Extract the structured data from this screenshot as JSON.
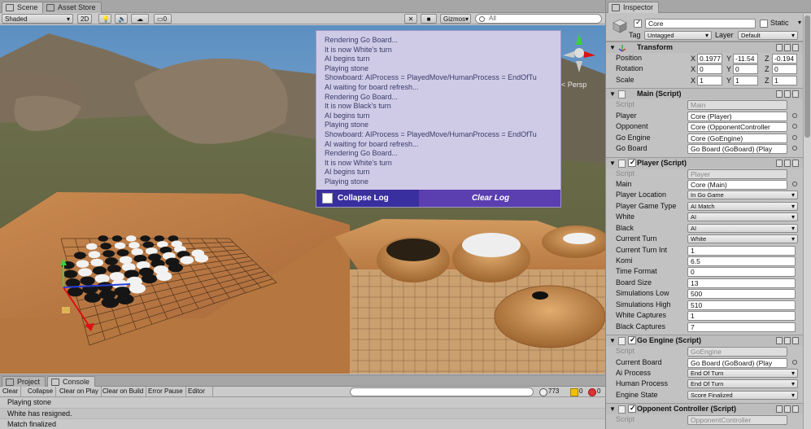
{
  "scene_panel": {
    "tabs": [
      {
        "label": "Scene",
        "active": true
      },
      {
        "label": "Asset Store",
        "active": false
      }
    ],
    "toolbar": {
      "shading_mode": "Shaded",
      "mode_2d": "2D",
      "audio_count": "0",
      "gizmos_label": "Gizmos",
      "search_placeholder": "All"
    },
    "persp_label": "< Persp",
    "debug_log": {
      "lines": [
        "Rendering Go Board...",
        "It is now White's turn",
        "AI begins turn",
        "Playing stone",
        "Showboard: AIProcess = PlayedMove/HumanProcess = EndOfTu",
        "AI waiting for board refresh...",
        "Rendering Go Board...",
        "It is now Black's turn",
        "AI begins turn",
        "Playing stone",
        "Showboard: AIProcess = PlayedMove/HumanProcess = EndOfTu",
        "AI waiting for board refresh...",
        "Rendering Go Board...",
        "It is now White's turn",
        "AI begins turn",
        "Playing stone"
      ],
      "collapse_label": "Collapse Log",
      "clear_label": "Clear Log"
    }
  },
  "inspector": {
    "tab_label": "Inspector",
    "gameobject": {
      "name": "Core",
      "static_label": "Static",
      "tag_label": "Tag",
      "tag_value": "Untagged",
      "layer_label": "Layer",
      "layer_value": "Default"
    },
    "transform": {
      "title": "Transform",
      "position": {
        "label": "Position",
        "x": "0.1977",
        "y": "-11.54",
        "z": "-0.194"
      },
      "rotation": {
        "label": "Rotation",
        "x": "0",
        "y": "0",
        "z": "0"
      },
      "scale": {
        "label": "Scale",
        "x": "1",
        "y": "1",
        "z": "1"
      }
    },
    "main_script": {
      "title": "Main (Script)",
      "script_label": "Script",
      "script_value": "Main",
      "player_label": "Player",
      "player_value": "Core (Player)",
      "opponent_label": "Opponent",
      "opponent_value": "Core (OpponentController",
      "go_engine_label": "Go Engine",
      "go_engine_value": "Core (GoEngine)",
      "go_board_label": "Go Board",
      "go_board_value": "Go Board (GoBoard) (Play"
    },
    "player_script": {
      "title": "Player (Script)",
      "script_label": "Script",
      "script_value": "Player",
      "main_label": "Main",
      "main_value": "Core (Main)",
      "player_location_label": "Player Location",
      "player_location_value": "In Go Game",
      "player_game_type_label": "Player Game Type",
      "player_game_type_value": "AI Match",
      "white_label": "White",
      "white_value": "AI",
      "black_label": "Black",
      "black_value": "AI",
      "current_turn_label": "Current Turn",
      "current_turn_value": "White",
      "current_turn_int_label": "Current Turn Int",
      "current_turn_int_value": "1",
      "komi_label": "Komi",
      "komi_value": "6.5",
      "time_format_label": "Time Format",
      "time_format_value": "0",
      "board_size_label": "Board Size",
      "board_size_value": "13",
      "simulations_low_label": "Simulations Low",
      "simulations_low_value": "500",
      "simulations_high_label": "Simulations High",
      "simulations_high_value": "510",
      "white_captures_label": "White Captures",
      "white_captures_value": "1",
      "black_captures_label": "Black Captures",
      "black_captures_value": "7"
    },
    "go_engine_script": {
      "title": "Go Engine (Script)",
      "script_label": "Script",
      "script_value": "GoEngine",
      "current_board_label": "Current Board",
      "current_board_value": "Go Board (GoBoard) (Play",
      "ai_process_label": "Ai Process",
      "ai_process_value": "End Of Turn",
      "human_process_label": "Human Process",
      "human_process_value": "End Of Turn",
      "engine_state_label": "Engine State",
      "engine_state_value": "Score Finalized"
    },
    "opponent_script": {
      "title": "Opponent Controller (Script)",
      "script_label": "Script",
      "script_value": "OpponentController"
    }
  },
  "console_panel": {
    "tabs": [
      {
        "label": "Project",
        "active": false
      },
      {
        "label": "Console",
        "active": true
      }
    ],
    "buttons": {
      "clear": "Clear",
      "collapse": "Collapse",
      "clear_on_play": "Clear on Play",
      "clear_on_build": "Clear on Build",
      "error_pause": "Error Pause",
      "editor": "Editor"
    },
    "counts": {
      "info": "773",
      "warn": "0",
      "error": "0"
    },
    "lines": [
      "Playing stone",
      "White has resigned.",
      "Match finalized"
    ]
  }
}
